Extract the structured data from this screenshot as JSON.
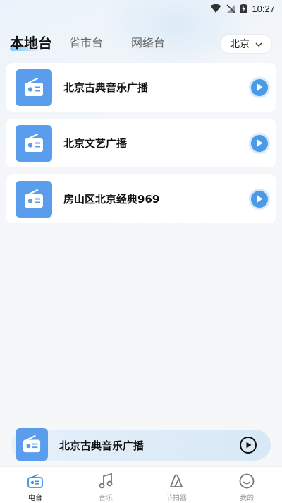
{
  "status_bar": {
    "time": "10:27"
  },
  "tabs": [
    {
      "label": "本地台",
      "active": true
    },
    {
      "label": "省市台",
      "active": false
    },
    {
      "label": "网络台",
      "active": false
    }
  ],
  "city_select": {
    "value": "北京"
  },
  "stations": [
    {
      "name": "北京古典音乐广播"
    },
    {
      "name": "北京文艺广播"
    },
    {
      "name": "房山区北京经典969"
    }
  ],
  "mini_player": {
    "title": "北京古典音乐广播"
  },
  "bottom_nav": [
    {
      "label": "电台",
      "icon": "radio-icon",
      "active": true
    },
    {
      "label": "音乐",
      "icon": "music-note-icon",
      "active": false
    },
    {
      "label": "节拍器",
      "icon": "metronome-icon",
      "active": false
    },
    {
      "label": "我的",
      "icon": "smile-face-icon",
      "active": false
    }
  ],
  "colors": {
    "accent": "#4a9ae8",
    "tile": "#5a9ded",
    "background": "#f6f7f9"
  }
}
